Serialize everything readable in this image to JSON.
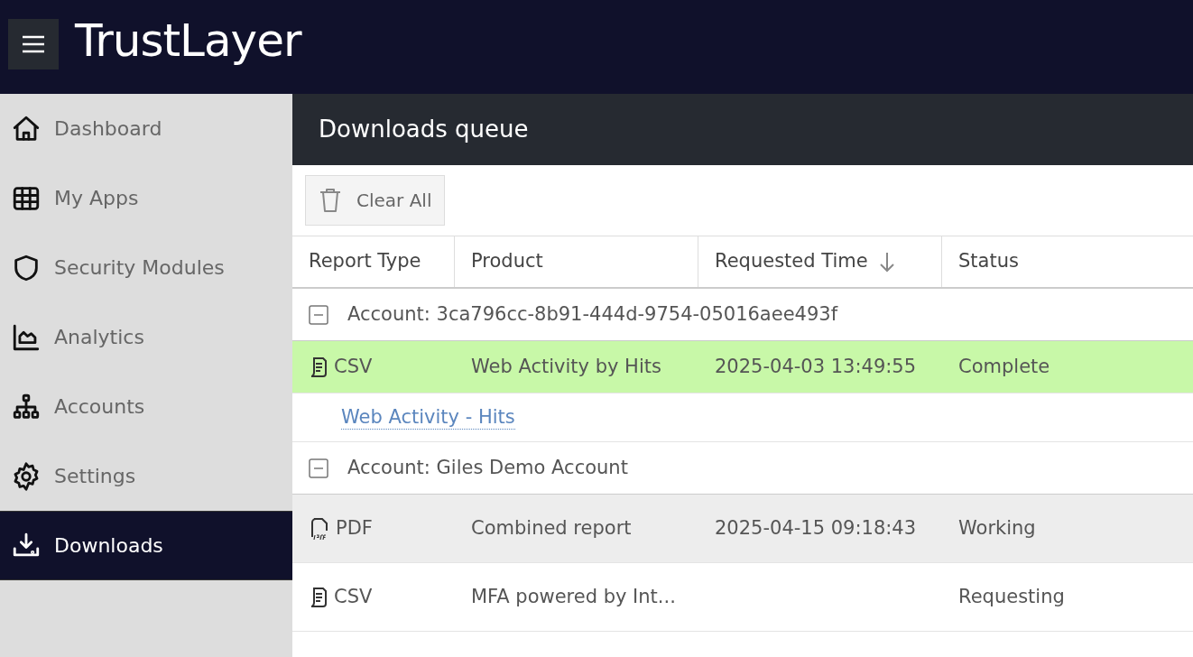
{
  "header": {
    "logo": "TrustLayer"
  },
  "sidebar": {
    "items": [
      {
        "label": "Dashboard",
        "selected": false
      },
      {
        "label": "My Apps",
        "selected": false
      },
      {
        "label": "Security Modules",
        "selected": false
      },
      {
        "label": "Analytics",
        "selected": false
      },
      {
        "label": "Accounts",
        "selected": false
      },
      {
        "label": "Settings",
        "selected": false
      },
      {
        "label": "Downloads",
        "selected": true
      }
    ]
  },
  "panel": {
    "title": "Downloads queue",
    "clear_button": "Clear All"
  },
  "table": {
    "columns": [
      {
        "label": "Report Type",
        "sorted": false
      },
      {
        "label": "Product",
        "sorted": false
      },
      {
        "label": "Requested Time",
        "sorted": true
      },
      {
        "label": "Status",
        "sorted": false
      }
    ],
    "groups": [
      {
        "label": "Account: 3ca796cc-8b91-444d-9754-05016aee493f",
        "expanded": true,
        "rows": [
          {
            "kind": "csv",
            "type": "CSV",
            "product": "Web Activity by Hits",
            "time": "2025-04-03 13:49:55",
            "status": "Complete",
            "selected": true,
            "hovered": false,
            "link": "Web Activity - Hits"
          }
        ]
      },
      {
        "label": "Account: Giles Demo Account",
        "expanded": true,
        "rows": [
          {
            "kind": "pdf",
            "type": "PDF",
            "product": "Combined report",
            "time": "2025-04-15 09:18:43",
            "status": "Working",
            "selected": false,
            "hovered": true
          },
          {
            "kind": "csv",
            "type": "CSV",
            "product": "MFA powered by Int...",
            "status": "Requesting",
            "selected": false,
            "hovered": false
          }
        ]
      }
    ]
  }
}
